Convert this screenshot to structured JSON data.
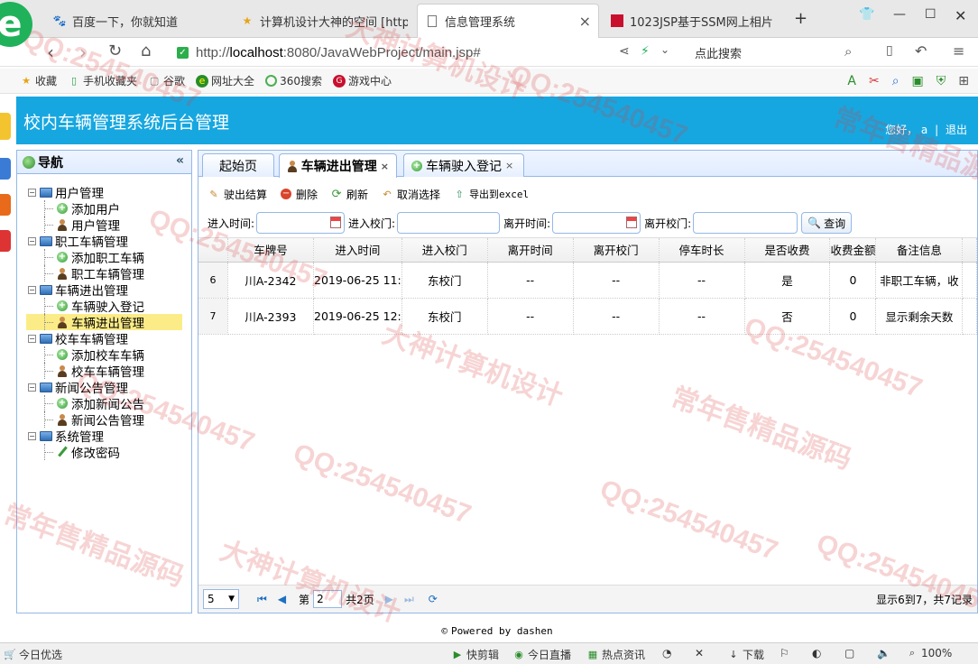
{
  "browser": {
    "tabs": [
      {
        "title": "百度一下，你就知道",
        "icon": "paw-icon"
      },
      {
        "title": "计算机设计大神的空间 [http",
        "icon": "star-icon"
      },
      {
        "title": "信息管理系统",
        "icon": "page-icon",
        "active": true,
        "close": "×"
      },
      {
        "title": "1023JSP基于SSM网上相片",
        "icon": "red-square-icon"
      }
    ],
    "new_tab": "+",
    "address": {
      "prefix": "http://",
      "host": "localhost",
      "rest": ":8080/JavaWebProject/main.jsp#"
    },
    "search_placeholder": "点此搜索",
    "bookmarks": [
      "收藏",
      "手机收藏夹",
      "谷歌",
      "网址大全",
      "360搜索",
      "游戏中心"
    ],
    "status_left": "今日优选",
    "status_items": [
      "快剪辑",
      "今日直播",
      "热点资讯",
      "下载",
      "100%"
    ]
  },
  "app": {
    "title": "校内车辆管理系统后台管理",
    "greeting": "您好，",
    "username": "a",
    "separator": "|",
    "logout": "退出",
    "footer": "Powered by dashen"
  },
  "nav": {
    "title": "导航",
    "collapse": "«",
    "groups": [
      {
        "label": "用户管理",
        "items": [
          "添加用户",
          "用户管理"
        ]
      },
      {
        "label": "职工车辆管理",
        "items": [
          "添加职工车辆",
          "职工车辆管理"
        ]
      },
      {
        "label": "车辆进出管理",
        "items": [
          "车辆驶入登记",
          "车辆进出管理"
        ]
      },
      {
        "label": "校车车辆管理",
        "items": [
          "添加校车车辆",
          "校车车辆管理"
        ]
      },
      {
        "label": "新闻公告管理",
        "items": [
          "添加新闻公告",
          "新闻公告管理"
        ]
      },
      {
        "label": "系统管理",
        "items": [
          "修改密码"
        ]
      }
    ],
    "selected": "车辆进出管理"
  },
  "main": {
    "tabs": [
      {
        "label": "起始页"
      },
      {
        "label": "车辆进出管理",
        "close": "×",
        "active": true
      },
      {
        "label": "车辆驶入登记",
        "close": "×"
      }
    ],
    "toolbar": [
      "驶出结算",
      "删除",
      "刷新",
      "取消选择",
      "导出到excel"
    ],
    "search": {
      "in_time_label": "进入时间:",
      "in_gate_label": "进入校门:",
      "out_time_label": "离开时间:",
      "out_gate_label": "离开校门:",
      "query_button": "查询"
    },
    "table": {
      "columns": [
        "车牌号",
        "进入时间",
        "进入校门",
        "离开时间",
        "离开校门",
        "停车时长",
        "是否收费",
        "收费金额",
        "备注信息"
      ],
      "rows": [
        {
          "num": "6",
          "cells": [
            "川A-2342",
            "2019-06-25 11:",
            "东校门",
            "--",
            "--",
            "--",
            "是",
            "0",
            "非职工车辆，收"
          ]
        },
        {
          "num": "7",
          "cells": [
            "川A-2393",
            "2019-06-25 12:",
            "东校门",
            "--",
            "--",
            "--",
            "否",
            "0",
            "显示剩余天数"
          ]
        }
      ]
    },
    "pager": {
      "page_size": "5",
      "page_label": "第",
      "page": "2",
      "total_pages": "共2页",
      "info": "显示6到7，共7记录"
    }
  },
  "watermarks": [
    "QQ:254540457",
    "大神计算机设计",
    "常年售精品源码"
  ],
  "colors": {
    "header": "#17a7e0",
    "border": "#95b8e7",
    "selected": "#fbec88"
  }
}
